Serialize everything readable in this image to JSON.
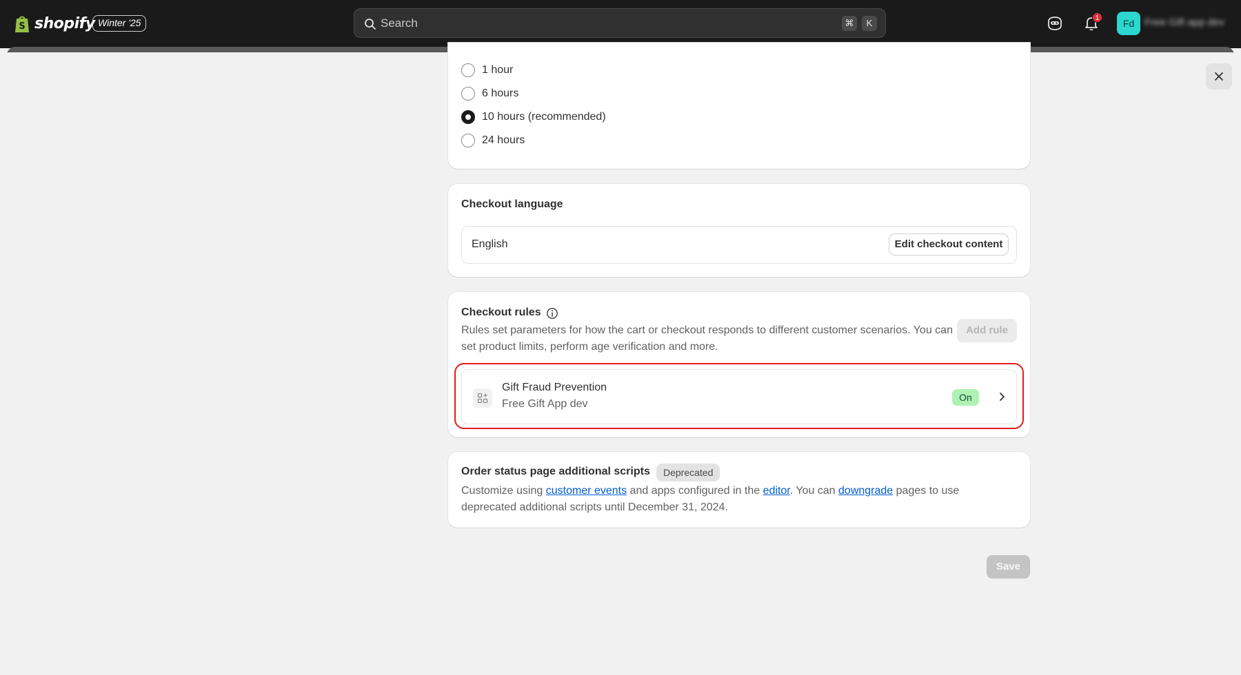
{
  "topbar": {
    "brand": "shopify",
    "version": "Winter '25",
    "search_placeholder": "Search",
    "shortcut_cmd": "⌘",
    "shortcut_key": "K",
    "notification_count": "1",
    "avatar_initials": "Fd",
    "store_name": "Free Gift app dev",
    "colors": {
      "bar": "#1a1a1a",
      "avatar": "#2bd7cf",
      "badge": "#e22c38"
    }
  },
  "abandoned": {
    "options": [
      {
        "label": "1 hour",
        "selected": false
      },
      {
        "label": "6 hours",
        "selected": false
      },
      {
        "label": "10 hours (recommended)",
        "selected": true
      },
      {
        "label": "24 hours",
        "selected": false
      }
    ]
  },
  "checkout_language": {
    "title": "Checkout language",
    "value": "English",
    "edit_label": "Edit checkout content"
  },
  "checkout_rules": {
    "title": "Checkout rules",
    "description": "Rules set parameters for how the cart or checkout responds to different customer scenarios. You can set product limits, perform age verification and more.",
    "add_label": "Add rule",
    "rule": {
      "name": "Gift Fraud Prevention",
      "app": "Free Gift App dev",
      "status": "On",
      "status_color": "#aff0b5"
    },
    "highlight_color": "#e21b1b"
  },
  "order_status": {
    "title": "Order status page additional scripts",
    "badge": "Deprecated",
    "text_1": "Customize using ",
    "link_1": "customer events",
    "text_2": " and apps configured in the ",
    "link_2": "editor",
    "text_3": ". You can ",
    "link_3": "downgrade",
    "text_4": " pages to use deprecated additional scripts until December 31, 2024."
  },
  "footer": {
    "save_label": "Save"
  }
}
